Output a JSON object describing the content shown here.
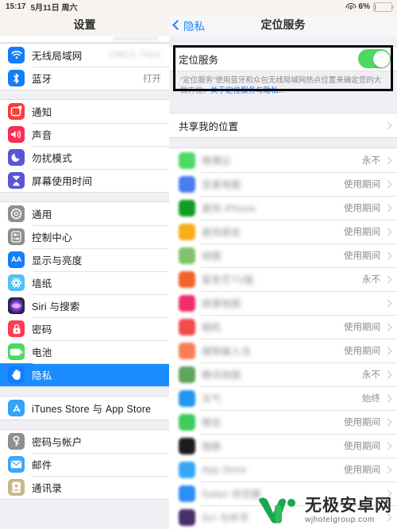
{
  "status_bar": {
    "time": "15:17",
    "date": "5月11日 周六",
    "wifi_icon": "wifi-icon",
    "battery_text": "6%",
    "battery_level": 6,
    "battery_color": "#ff3b30"
  },
  "sidebar": {
    "title": "设置",
    "groups": [
      {
        "items": [
          {
            "label": "无线局域网",
            "value": "CMCC-7Nu1",
            "value_blurred": true,
            "icon": "wifi-icon",
            "color": "#147efb"
          },
          {
            "label": "蓝牙",
            "value": "打开",
            "value_blurred": false,
            "icon": "bluetooth-icon",
            "color": "#147efb"
          }
        ]
      },
      {
        "items": [
          {
            "label": "通知",
            "value": "",
            "icon": "notifications-icon",
            "color": "#fc3d39"
          },
          {
            "label": "声音",
            "value": "",
            "icon": "sound-icon",
            "color": "#fc2d55"
          },
          {
            "label": "勿扰模式",
            "value": "",
            "icon": "moon-icon",
            "color": "#5856d6"
          },
          {
            "label": "屏幕使用时间",
            "value": "",
            "icon": "hourglass-icon",
            "color": "#5756d5"
          }
        ]
      },
      {
        "items": [
          {
            "label": "通用",
            "value": "",
            "icon": "gear-icon",
            "color": "#8e8e93"
          },
          {
            "label": "控制中心",
            "value": "",
            "icon": "control-center-icon",
            "color": "#8e8e93"
          },
          {
            "label": "显示与亮度",
            "value": "",
            "icon": "display-icon",
            "color": "#147efb"
          },
          {
            "label": "墙纸",
            "value": "",
            "icon": "wallpaper-icon",
            "color": "#4fc3f7"
          },
          {
            "label": "Siri 与搜索",
            "value": "",
            "icon": "siri-icon",
            "color": "#2b2340"
          },
          {
            "label": "密码",
            "value": "",
            "icon": "lock-icon",
            "color": "#fc3d52"
          },
          {
            "label": "电池",
            "value": "",
            "icon": "battery-icon",
            "color": "#4cd964"
          },
          {
            "label": "隐私",
            "value": "",
            "icon": "hand-icon",
            "color": "#147efb",
            "selected": true
          }
        ]
      },
      {
        "items": [
          {
            "label": "iTunes Store 与 App Store",
            "value": "",
            "icon": "app-store-icon",
            "color": "#32a4fb"
          }
        ]
      },
      {
        "items": [
          {
            "label": "密码与帐户",
            "value": "",
            "icon": "key-icon",
            "color": "#8e8e93"
          },
          {
            "label": "邮件",
            "value": "",
            "icon": "mail-icon",
            "color": "#3ea6f7"
          },
          {
            "label": "通讯录",
            "value": "",
            "icon": "contacts-icon",
            "color": "#c9b98a"
          }
        ]
      }
    ]
  },
  "detail": {
    "back_label": "隐私",
    "title": "定位服务",
    "master_switch": {
      "label": "定位服务",
      "enabled": true,
      "switch_color": "#4cd964",
      "highlighted": true
    },
    "footnote_text": "“定位服务”使用蓝牙和众包无线局域网热点位置来确定您的大致方位。",
    "footnote_link": "关于定位服务与隐私...",
    "share_location": {
      "label": "共享我的位置",
      "value": ""
    },
    "apps": [
      {
        "name": "微博云",
        "value": "永不",
        "color": "#4cd964"
      },
      {
        "name": "百度地图",
        "value": "使用期间",
        "color": "#4a7df5"
      },
      {
        "name": "查找 iPhone",
        "value": "使用期间",
        "color": "#0f9d26"
      },
      {
        "name": "查找朋友",
        "value": "使用期间",
        "color": "#f9ae1b"
      },
      {
        "name": "地图",
        "value": "使用期间",
        "color": "#7fc46b"
      },
      {
        "name": "爱奇艺TV版",
        "value": "永不",
        "color": "#f2622d"
      },
      {
        "name": "高德地图",
        "value": "",
        "color": "#f02e6e"
      },
      {
        "name": "相机",
        "value": "使用期间",
        "color": "#f24b4b"
      },
      {
        "name": "搜狗输入法",
        "value": "使用期间",
        "color": "#fa7e55"
      },
      {
        "name": "腾讯地图",
        "value": "永不",
        "color": "#5fa55a"
      },
      {
        "name": "天气",
        "value": "始终",
        "color": "#2196f3"
      },
      {
        "name": "微信",
        "value": "使用期间",
        "color": "#3ecc5f"
      },
      {
        "name": "相册",
        "value": "使用期间",
        "color": "#1c1c1e"
      },
      {
        "name": "App Store",
        "value": "使用期间",
        "color": "#39a7f7"
      },
      {
        "name": "Safari 浏览器",
        "value": "",
        "color": "#2f8ef5"
      },
      {
        "name": "Siri 与听写",
        "value": "",
        "color": "#4a2e6b"
      }
    ]
  },
  "watermark": {
    "logo": "w-logo-icon",
    "name_cn": "无极安卓网",
    "name_en": "wjhotelgroup.com",
    "color": "#1aa84f"
  }
}
